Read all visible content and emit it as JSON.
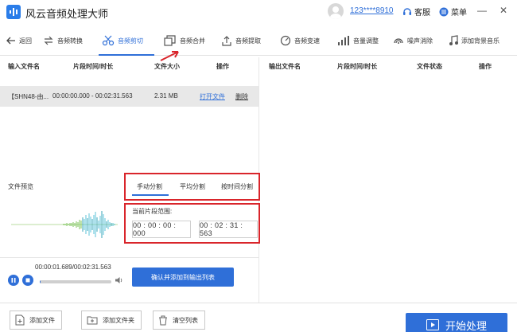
{
  "app": {
    "title": "风云音频处理大师"
  },
  "header": {
    "user": "123****8910",
    "service": "客服",
    "menu": "菜单"
  },
  "toolbar": {
    "back": "返回",
    "items": [
      "音频转换",
      "音频剪切",
      "音频合并",
      "音频提取",
      "音频变速",
      "音量调整",
      "噪声消除",
      "添加背景音乐"
    ],
    "active": "音频剪切"
  },
  "input_table": {
    "headers": [
      "输入文件名",
      "片段时间/时长",
      "文件大小",
      "操作"
    ],
    "rows": [
      {
        "name": "【SHN48-由...",
        "segment": "00:00:00.000 - 00:02:31.563",
        "size": "2.31 MB",
        "open": "打开文件",
        "delete": "删除"
      }
    ]
  },
  "output_table": {
    "headers": [
      "输出文件名",
      "片段时间/时长",
      "文件状态",
      "操作"
    ]
  },
  "preview": {
    "label": "文件预览",
    "tabs": [
      "手动分割",
      "平均分割",
      "按时间分割"
    ],
    "range_label": "当前片段范围:",
    "start_time": "00 : 00 : 00 : 000",
    "end_time": "00 : 02 : 31 : 563",
    "play_time": "00:00:01.689/00:02:31.563",
    "progress": 0.011,
    "confirm": "确认并添加到输出列表"
  },
  "bottom": {
    "add_file": "添加文件",
    "add_folder": "添加文件夹",
    "clear": "清空列表",
    "start": "开始处理"
  },
  "colors": {
    "accent": "#2f6fd8",
    "highlight": "#d9252b"
  }
}
